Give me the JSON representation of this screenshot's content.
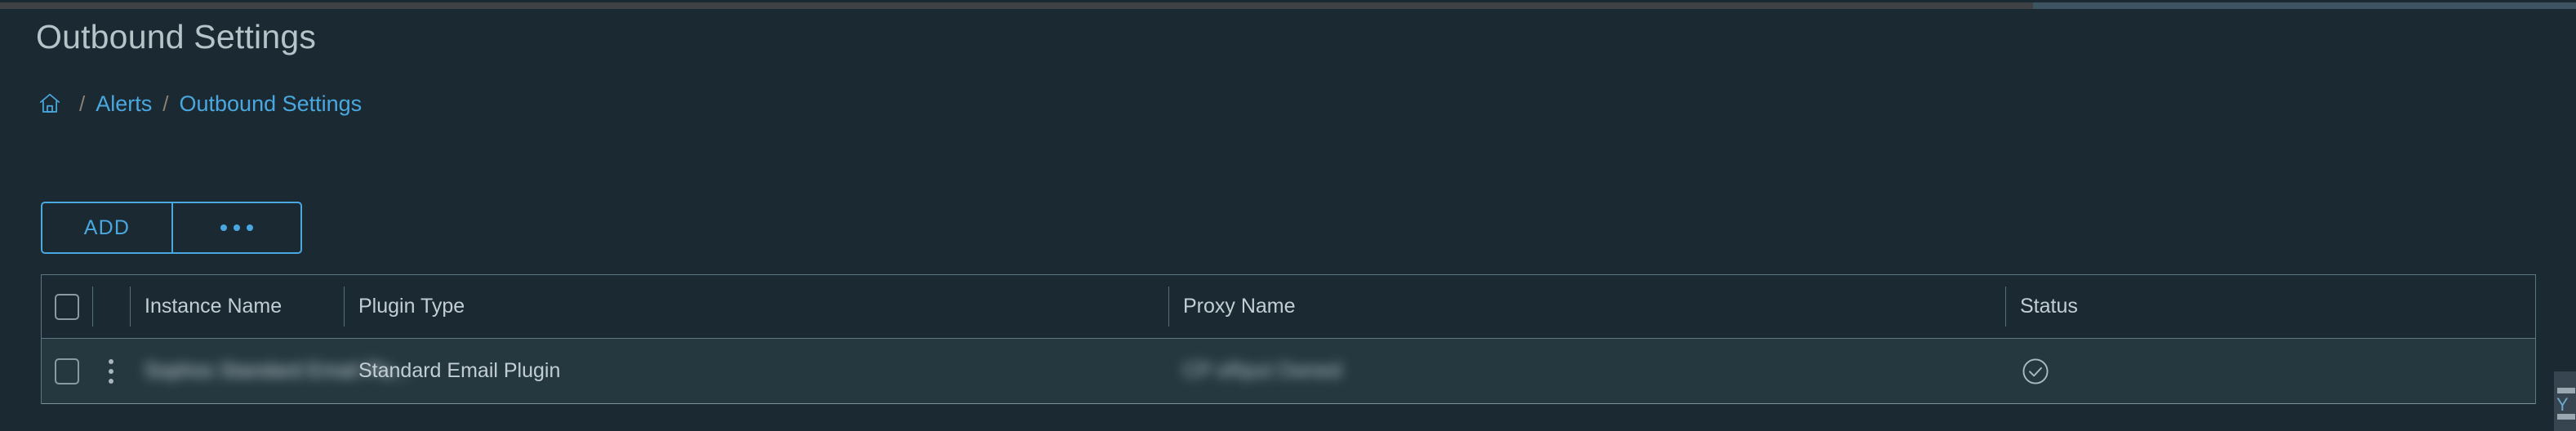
{
  "window": {
    "top_strip_left_color": "#3e4245",
    "top_strip_right_color": "#3e5462"
  },
  "theme": {
    "background": "#1b2a32",
    "accent": "#4aa8e0",
    "text": "#c3ced4",
    "title_text": "#b6c4c9",
    "grid_border": "#5d7682",
    "row_background": "#253840"
  },
  "header": {
    "title": "Outbound Settings"
  },
  "breadcrumb": {
    "home_icon": "home-icon",
    "separator": "/",
    "items": [
      {
        "label": "Alerts"
      },
      {
        "label": "Outbound Settings"
      }
    ]
  },
  "toolbar": {
    "add_label": "ADD",
    "more_label": "•••",
    "more_icon": "ellipsis-horizontal-icon"
  },
  "table": {
    "select_all_checkbox": "",
    "columns": [
      {
        "key": "instance_name",
        "label": "Instance Name"
      },
      {
        "key": "plugin_type",
        "label": "Plugin Type"
      },
      {
        "key": "proxy_name",
        "label": "Proxy Name"
      },
      {
        "key": "status",
        "label": "Status"
      }
    ],
    "rows": [
      {
        "checkbox": "",
        "row_menu_icon": "kebab-menu-icon",
        "instance_name": "Sophos Standard Email Plu...",
        "instance_name_redacted": true,
        "plugin_type": "Standard Email Plugin",
        "proxy_name": "CP oRput Owned",
        "proxy_name_redacted": true,
        "status_icon": "check-circle-icon",
        "status_value": "Enabled"
      }
    ]
  }
}
